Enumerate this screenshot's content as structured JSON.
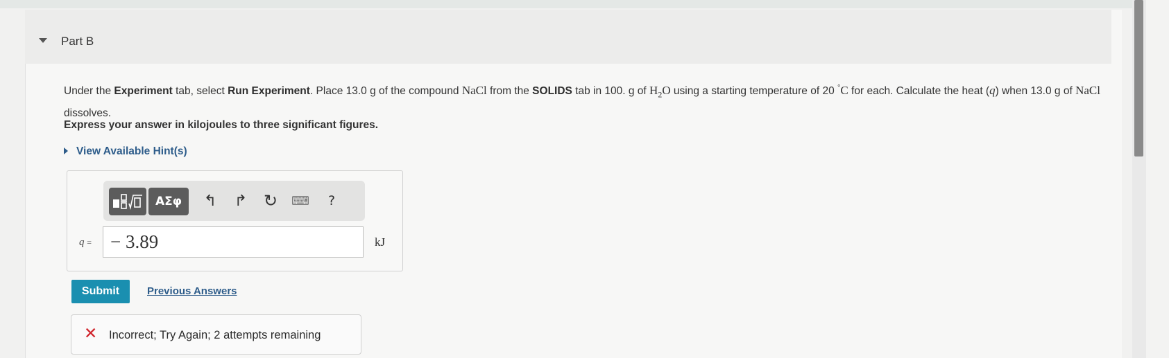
{
  "part": {
    "title": "Part B"
  },
  "question": {
    "s1": "Under the ",
    "b1": "Experiment",
    "s2": " tab, select ",
    "b2": "Run Experiment",
    "s3": ". Place 13.0 g of the compound ",
    "nacl": "NaCl",
    "s4": " from the ",
    "b3": "SOLIDS",
    "s5": " tab in 100. g of ",
    "h": "H",
    "h_sub": "2",
    "o": "O",
    "s6": " using a starting temperature of 20 ",
    "deg": "°",
    "c": "C",
    "s7": " for each. Calculate the heat (",
    "q": "q",
    "s8": ") when 13.0 g of ",
    "nacl2": "NaCl",
    "s9": " dissolves."
  },
  "instruction": "Express your answer in kilojoules to three significant figures.",
  "hints": {
    "label": "View Available Hint(s)"
  },
  "toolbar": {
    "greek_label": "ΑΣφ",
    "undo_glyph": "↰",
    "redo_glyph": "↱",
    "reset_glyph": "↻",
    "keyboard_glyph": "⌨",
    "help_label": "?"
  },
  "answer": {
    "variable": "q",
    "equals": "=",
    "value": "− 3.89",
    "unit": "kJ"
  },
  "actions": {
    "submit_label": "Submit",
    "previous_answers_label": "Previous Answers"
  },
  "feedback": {
    "icon": "x-mark-icon",
    "message": "Incorrect; Try Again; 2 attempts remaining",
    "color": "#d0232b"
  },
  "colors": {
    "accent": "#1a8fb0",
    "link": "#2d5c8a"
  }
}
